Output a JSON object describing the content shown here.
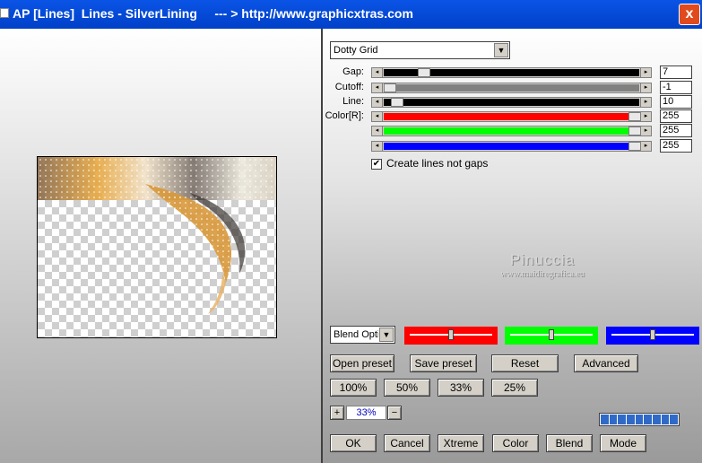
{
  "window": {
    "title": "AP [Lines]  Lines - SilverLining     --- > http://www.graphicxtras.com",
    "close_label": "x"
  },
  "effect_dropdown": {
    "value": "Dotty Grid"
  },
  "params": [
    {
      "label": "Gap:",
      "value": "7",
      "level": 0.14,
      "color": "#000000"
    },
    {
      "label": "Cutoff:",
      "value": "-1",
      "level": 0.0,
      "color": "#808080"
    },
    {
      "label": "Line:",
      "value": "10",
      "level": 0.03,
      "color": "#000000"
    },
    {
      "label": "Color[R]:",
      "value": "255",
      "level": 1.0,
      "color": "#ff0000"
    },
    {
      "label": "",
      "value": "255",
      "level": 1.0,
      "color": "#00ff00"
    },
    {
      "label": "",
      "value": "255",
      "level": 1.0,
      "color": "#0000ff"
    }
  ],
  "checkbox": {
    "label": "Create lines not gaps",
    "checked": true,
    "mark": "✔"
  },
  "watermark": {
    "line1": "Pinuccia",
    "line2": "www.maidiregrafica.eu"
  },
  "blend": {
    "dropdown_value": "Blend Optio",
    "sliders": [
      {
        "color": "#ff0000",
        "level": 0.5
      },
      {
        "color": "#00ff00",
        "level": 0.5
      },
      {
        "color": "#0000ff",
        "level": 0.5
      }
    ]
  },
  "buttons_row1": [
    "Open preset",
    "Save preset",
    "Reset",
    "Advanced"
  ],
  "zoom_buttons": [
    "100%",
    "50%",
    "33%",
    "25%"
  ],
  "zoom": {
    "plus": "+",
    "value": "33%",
    "minus": "−"
  },
  "progress": {
    "segments": 9
  },
  "buttons_bottom": [
    "OK",
    "Cancel",
    "Xtreme",
    "Color",
    "Blend",
    "Mode"
  ]
}
